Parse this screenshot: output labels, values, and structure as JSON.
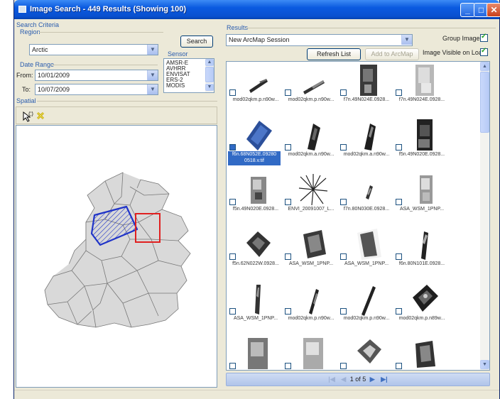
{
  "window": {
    "title": "Image Search - 449 Results (Showing 100)"
  },
  "search": {
    "criteria_label": "Search Criteria",
    "region_label": "Region",
    "region_value": "Arctic",
    "search_button": "Search",
    "sensor_label": "Sensor",
    "sensors": [
      "AMSR-E",
      "AVHRR",
      "ENVISAT",
      "ERS-2",
      "MODIS"
    ],
    "date_range_label": "Date Range",
    "from_label": "From:",
    "from_value": "10/01/2009",
    "to_label": "To:",
    "to_value": "10/07/2009",
    "spatial_label": "Spatial"
  },
  "results": {
    "label": "Results",
    "session_value": "New ArcMap Session",
    "group_images_label": "Group Images",
    "group_images_checked": true,
    "refresh_button": "Refresh List",
    "add_button": "Add to ArcMap",
    "visible_on_load_label": "Image Visible on Load",
    "visible_on_load_checked": true,
    "items": [
      "mod02qkm.p.n90w...",
      "mod02qkm.p.n90w...",
      "f7n.49N024E.0928...",
      "f7n.49N024E.0928...",
      "f6n.68N052E.09280 0518.v.tif",
      "mod02qkm.a.n90w...",
      "mod02qkm.a.n90w...",
      "f5n.49N020E.0928...",
      "f5n.49N020E.0928...",
      "ENVI_20091007_L...",
      "f7n.80N030E.0928...",
      "ASA_WSM_1PNP...",
      "f5n.62N022W.0928...",
      "ASA_WSM_1PNP...",
      "ASA_WSM_1PNP...",
      "f6n.80N101E.0928...",
      "ASA_WSM_1PNP...",
      "mod02qkm.p.n90w...",
      "mod02qkm.p.n90w...",
      "mod02qkm.p.n89w..."
    ],
    "pager": {
      "current": "1",
      "of_label": "of",
      "total": "5"
    }
  },
  "colors": {
    "accent": "#316ac5",
    "titlebar": "#0a5ae0",
    "aoi_box": "#2034c8",
    "selection_box": "#e02020"
  },
  "icons": [
    "select-arrow-icon",
    "clear-selection-icon",
    "first-page-icon",
    "prev-page-icon",
    "next-page-icon",
    "last-page-icon"
  ]
}
